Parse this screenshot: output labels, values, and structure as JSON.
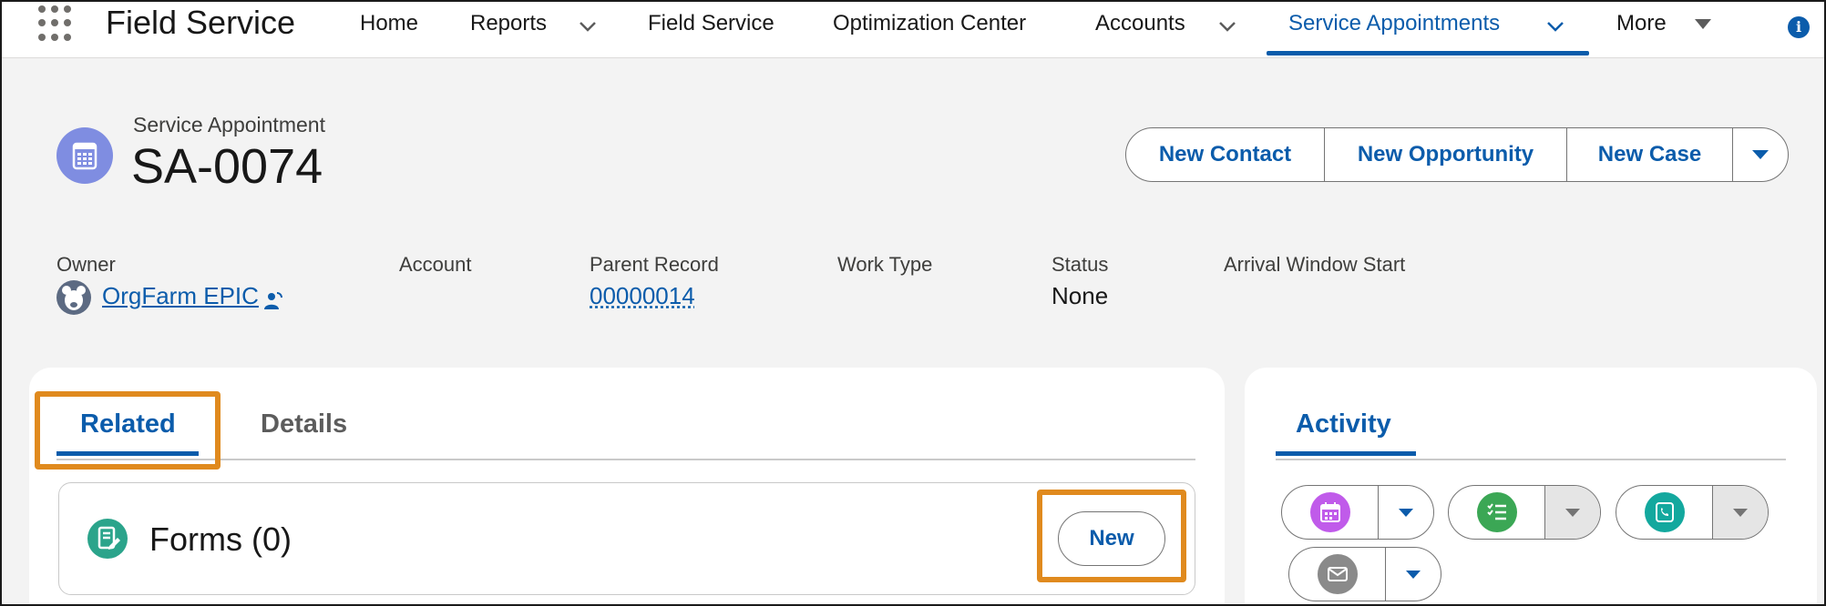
{
  "app": {
    "name": "Field Service"
  },
  "nav": {
    "items": [
      {
        "label": "Home"
      },
      {
        "label": "Reports"
      },
      {
        "label": "Field Service"
      },
      {
        "label": "Optimization Center"
      },
      {
        "label": "Accounts"
      },
      {
        "label": "Service Appointments"
      },
      {
        "label": "More"
      }
    ],
    "active": "Service Appointments"
  },
  "record": {
    "type": "Service Appointment",
    "title": "SA-0074",
    "actions": [
      "New Contact",
      "New Opportunity",
      "New Case"
    ]
  },
  "fields": [
    {
      "label": "Owner",
      "value": "OrgFarm EPIC"
    },
    {
      "label": "Account",
      "value": ""
    },
    {
      "label": "Parent Record",
      "value": "00000014"
    },
    {
      "label": "Work Type",
      "value": ""
    },
    {
      "label": "Status",
      "value": "None"
    },
    {
      "label": "Arrival Window Start",
      "value": ""
    }
  ],
  "tabs": [
    {
      "label": "Related",
      "selected": true
    },
    {
      "label": "Details",
      "selected": false
    }
  ],
  "related": {
    "forms_title": "Forms (0)",
    "new_label": "New"
  },
  "activity": {
    "tab_label": "Activity",
    "buttons": [
      {
        "icon": "calendar-icon",
        "color": "#c05bea"
      },
      {
        "icon": "task-list-icon",
        "color": "#3ba755"
      },
      {
        "icon": "phone-icon",
        "color": "#13a89e"
      },
      {
        "icon": "email-icon",
        "color": "#8a8a8a"
      }
    ]
  },
  "colors": {
    "accent": "#0b5cab",
    "highlight": "#e08a1e"
  }
}
